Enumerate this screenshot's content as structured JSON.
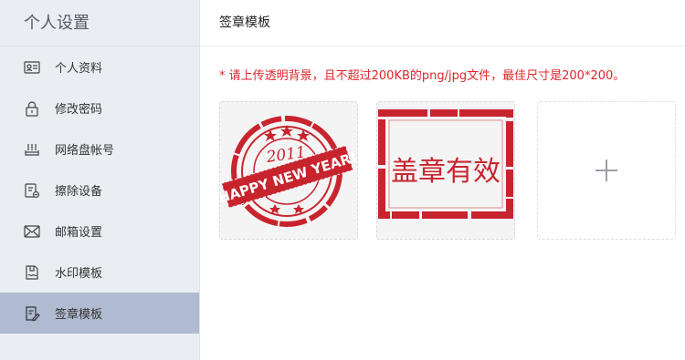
{
  "sidebar": {
    "title": "个人设置",
    "items": [
      {
        "label": "个人资料",
        "icon": "id-card-icon",
        "active": false
      },
      {
        "label": "修改密码",
        "icon": "lock-icon",
        "active": false
      },
      {
        "label": "网络盘帐号",
        "icon": "network-drive-icon",
        "active": false
      },
      {
        "label": "擦除设备",
        "icon": "erase-device-icon",
        "active": false
      },
      {
        "label": "邮箱设置",
        "icon": "mail-icon",
        "active": false
      },
      {
        "label": "水印模板",
        "icon": "watermark-icon",
        "active": false
      },
      {
        "label": "签章模板",
        "icon": "stamp-template-icon",
        "active": true
      }
    ]
  },
  "main": {
    "title": "签章模板",
    "notice": "* 请上传透明背景，且不超过200KB的png/jpg文件，最佳尺寸是200*200。",
    "stamps": [
      {
        "kind": "round-seal",
        "year": "2011",
        "banner": "HAPPY NEW YEAR!"
      },
      {
        "kind": "rect-seal",
        "text": "盖章有效"
      }
    ],
    "add_button": {
      "icon": "plus-icon"
    }
  },
  "colors": {
    "sidebar_bg": "#eaedf2",
    "active_item_bg": "#b0bad0",
    "notice_red": "#e0262b",
    "stamp_red": "#c8242e"
  }
}
